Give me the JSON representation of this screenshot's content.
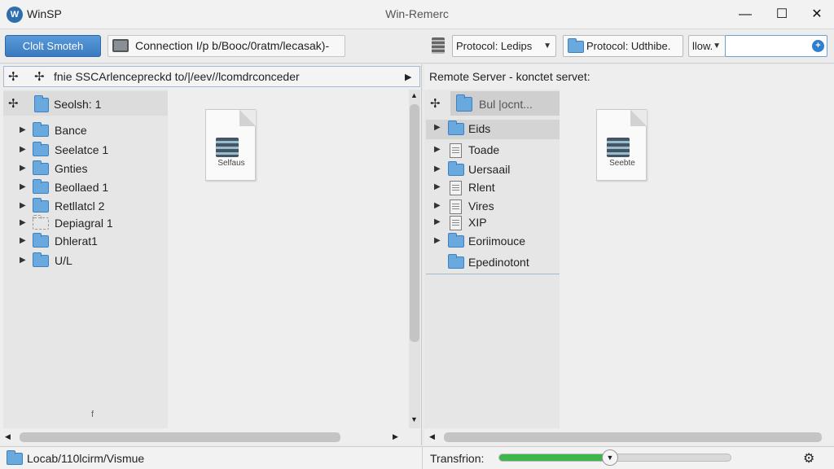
{
  "app": {
    "name": "WinSP",
    "window_title": "Win-Remerc"
  },
  "window_controls": {
    "minimize": "—",
    "maximize": "☐",
    "close": "✕"
  },
  "toolbar": {
    "connect_label": "Clolt Smoteh",
    "connection_text": "Connection I/p b/Booc/0ratm/lecasak)-",
    "protocol_dropdown": "Protocol: Ledips",
    "protocol_folder_dropdown": "Protocol: Udthibe.",
    "small_dropdown": "llow.",
    "search_value": ""
  },
  "left_pane": {
    "path": "fnie SSCArlencepreckd to/|/eev//lcomdrconceder",
    "current_folder": "Seolsh: 1",
    "tree": [
      {
        "label": "Bance",
        "icon": "folder-icon"
      },
      {
        "label": "Seelatce 1",
        "icon": "folder-icon"
      },
      {
        "label": "Gnties",
        "icon": "folder-icon"
      },
      {
        "label": "Beollaed 1",
        "icon": "folder-icon"
      },
      {
        "label": "Retllatcl 2",
        "icon": "folder-icon"
      },
      {
        "label": "Depiagral 1",
        "icon": "dashed-folder-icon"
      },
      {
        "label": "Dhlerat1",
        "icon": "folder-icon"
      },
      {
        "label": "U/L",
        "icon": "folder-icon"
      }
    ],
    "file_card_label": "Selfaus",
    "sort_mark": "f"
  },
  "right_pane": {
    "header": "Remote Server - konctet servet:",
    "current_folder": "Bul |ocnt...",
    "tree": [
      {
        "label": "Eids",
        "icon": "folder-icon",
        "selected": true
      },
      {
        "label": "Toade",
        "icon": "document-icon"
      },
      {
        "label": "Uersaail",
        "icon": "folder-icon"
      },
      {
        "label": "Rlent",
        "icon": "document-icon"
      },
      {
        "label": "Vires",
        "icon": "document-icon"
      },
      {
        "label": "XIP",
        "icon": "document-icon"
      },
      {
        "label": "Eoriimouce",
        "icon": "folder-icon"
      },
      {
        "label": "Epedinotont",
        "icon": "folder-icon"
      }
    ],
    "file_card_label": "Seebte"
  },
  "status": {
    "local_path": "Locab/110lcirm/Vismue",
    "transfer_label": "Transfrion:",
    "transfer_progress": 0.48,
    "progress_color": "#3fb64b",
    "accent_color": "#3a7bc0"
  }
}
